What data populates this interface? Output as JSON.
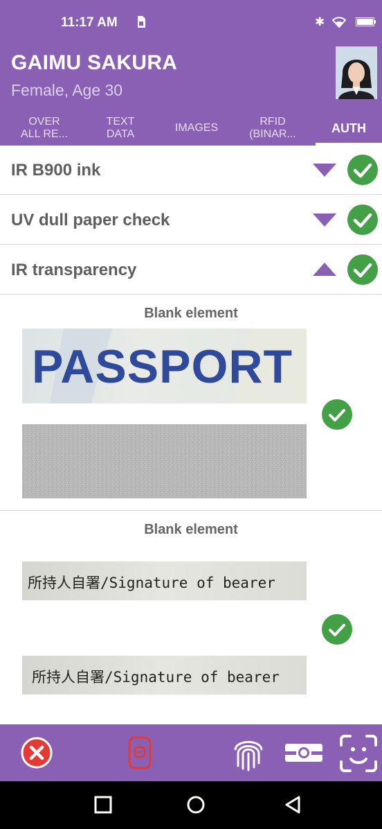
{
  "status_bar": {
    "time": "11:17 AM"
  },
  "profile": {
    "name": "GAIMU SAKURA",
    "subtitle": "Female, Age 30"
  },
  "tabs": [
    {
      "line1": "OVER",
      "line2": "ALL RE..."
    },
    {
      "line1": "TEXT",
      "line2": "DATA"
    },
    {
      "line1": "IMAGES",
      "line2": ""
    },
    {
      "line1": "RFID",
      "line2": "(BINAR..."
    },
    {
      "line1": "AUTH",
      "line2": ""
    }
  ],
  "checks": [
    {
      "label": "IR B900 ink",
      "expanded": false,
      "status": "ok"
    },
    {
      "label": "UV dull paper check",
      "expanded": false,
      "status": "ok"
    },
    {
      "label": "IR transparency",
      "expanded": true,
      "status": "ok"
    }
  ],
  "elements": [
    {
      "title": "Blank element",
      "image_text": "PASSPORT",
      "status": "ok"
    },
    {
      "title": "Blank element",
      "image_text_top": "所持人自署/Signature of bearer",
      "image_text_bottom": "所持人自署/Signature of bearer",
      "status": "ok"
    }
  ],
  "icons": {
    "close": "close-circle-icon",
    "rfid": "rfid-chip-icon",
    "fingerprint": "fingerprint-icon",
    "scan": "document-scan-icon",
    "face": "face-scan-icon"
  },
  "colors": {
    "brand": "#8a60b5",
    "success": "#43a047",
    "error": "#e53935"
  }
}
